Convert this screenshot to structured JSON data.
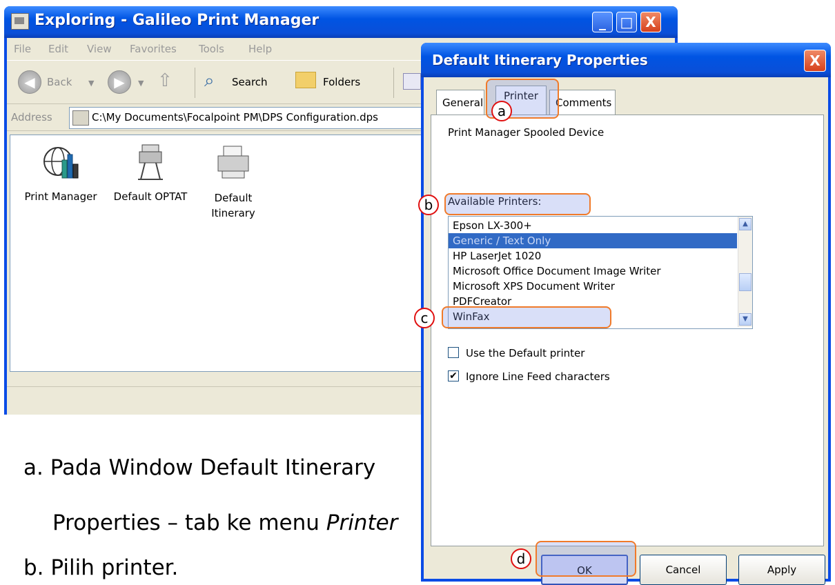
{
  "explorer": {
    "title": "Exploring - Galileo Print Manager",
    "window_buttons": {
      "minimize": "_",
      "maximize": "□",
      "close": "X"
    },
    "menu": [
      "File",
      "Edit",
      "View",
      "Favorites",
      "Tools",
      "Help"
    ],
    "toolbar": {
      "back": "Back",
      "search": "Search",
      "folders": "Folders"
    },
    "address_label": "Address",
    "address_value": "C:\\My Documents\\Focalpoint PM\\DPS Configuration.dps",
    "items": [
      {
        "label": "Print Manager",
        "icon": "globe-chart-icon"
      },
      {
        "label": "Default OPTAT",
        "icon": "plotter-icon"
      },
      {
        "label": "Default Itinerary",
        "icon": "printer-icon"
      }
    ]
  },
  "dialog": {
    "title": "Default Itinerary Properties",
    "close": "X",
    "tabs": [
      "General",
      "Printer",
      "Comments"
    ],
    "device_label": "Print Manager Spooled Device",
    "available_label": "Available Printers:",
    "printers": [
      "Epson LX-300+",
      "Generic / Text Only",
      "HP LaserJet 1020",
      "Microsoft Office Document Image Writer",
      "Microsoft XPS Document Writer",
      "PDFCreator",
      "WinFax"
    ],
    "selected_printer": "Generic / Text Only",
    "checkboxes": [
      {
        "label": "Use the Default printer",
        "checked": false
      },
      {
        "label": "Ignore Line Feed characters",
        "checked": true
      }
    ],
    "buttons": {
      "ok": "OK",
      "cancel": "Cancel",
      "apply": "Apply"
    }
  },
  "annotations": {
    "a": "a",
    "b": "b",
    "c": "c",
    "d": "d"
  },
  "instructions": {
    "line1": "a. Pada Window Default Itinerary",
    "line2_prefix": "Properties – tab ke menu ",
    "line2_em": "Printer",
    "line3": "b. Pilih printer."
  },
  "colors": {
    "titlebar": "#0054e3",
    "selection": "#316ac5",
    "highlight_border": "#f07a2a",
    "marker": "#e01010"
  }
}
